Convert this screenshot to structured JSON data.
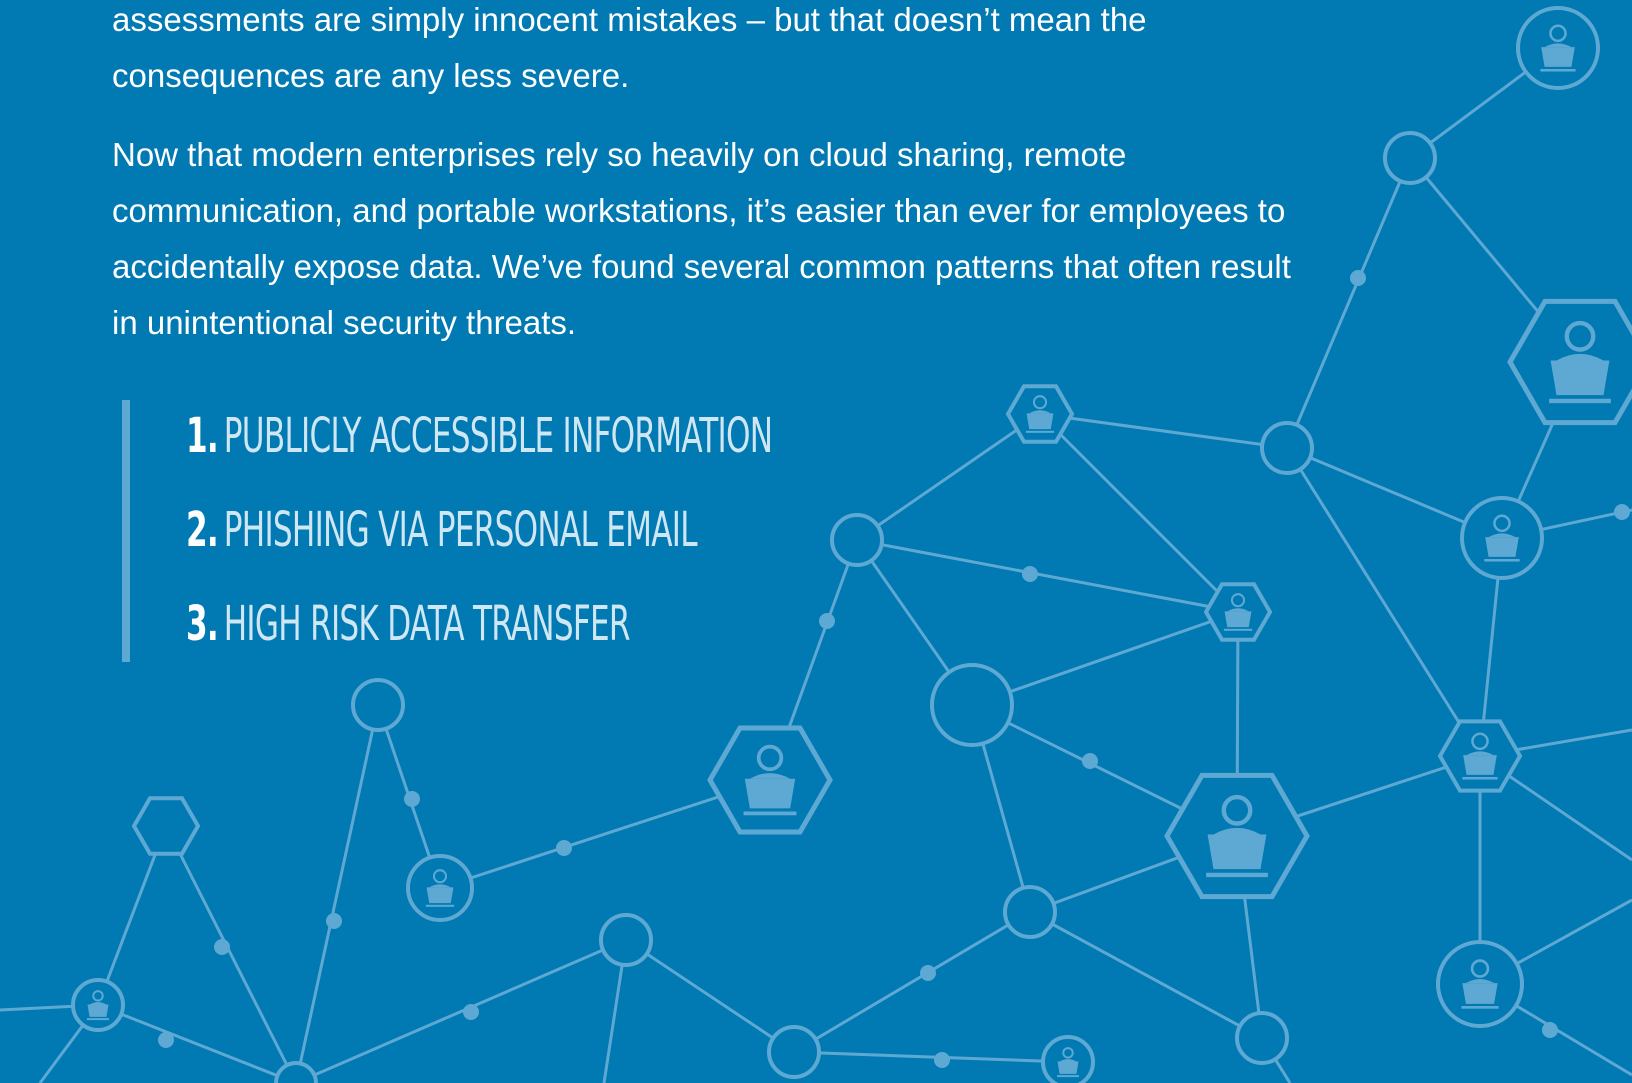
{
  "intro": {
    "paragraph1": "assessments are simply innocent mistakes – but that doesn’t mean the consequences are any less severe.",
    "paragraph2": "Now that modern enterprises rely so heavily on cloud sharing, remote communication, and portable workstations, it’s easier than ever for employees to accidentally expose data. We’ve found several common patterns that often result in unintentional security threats."
  },
  "threats": [
    {
      "number": "1.",
      "label": "PUBLICLY ACCESSIBLE INFORMATION"
    },
    {
      "number": "2.",
      "label": "PHISHING VIA PERSONAL EMAIL"
    },
    {
      "number": "3.",
      "label": "HIGH RISK DATA TRANSFER"
    }
  ],
  "colors": {
    "background": "#0179b2",
    "network_lines": "#5ea9d3",
    "accent_bar": "#5ea9d3",
    "text": "#ffffff"
  },
  "icons": [
    "user-laptop-icon",
    "network-node-icon"
  ]
}
